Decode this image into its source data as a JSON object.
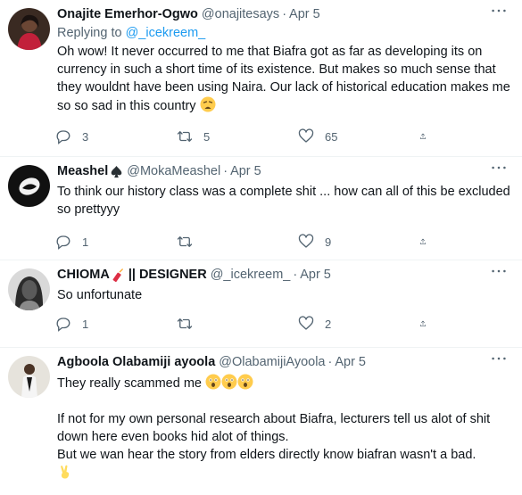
{
  "tweets": [
    {
      "name": "Onajite Emerhor-Ogwo",
      "handle": "@onajitesays",
      "time": "Apr 5",
      "replying_label": "Replying to",
      "replying_handle": "@_icekreem_",
      "text": "Oh wow! It never occurred to me that Biafra got as far as developing its on currency in such a short time of its existence. But makes so much sense that they wouldnt have been using Naira. Our lack of historical education makes me so so sad in this country",
      "text_emoji": "weary-face",
      "replies": "3",
      "retweets": "5",
      "likes": "65"
    },
    {
      "name": "Meashel",
      "name_emoji": "spade-suit",
      "handle": "@MokaMeashel",
      "time": "Apr 5",
      "text": "To think our history class was a complete shit ... how can all of this be excluded so prettyyy",
      "replies": "1",
      "retweets": "",
      "likes": "9"
    },
    {
      "name": "CHIOMA",
      "name_emoji": "firecracker",
      "name_suffix": "|| DESIGNER",
      "handle": "@_icekreem_",
      "time": "Apr 5",
      "text": "So unfortunate",
      "replies": "1",
      "retweets": "",
      "likes": "2"
    },
    {
      "name": "Agboola Olabamiji ayoola",
      "handle": "@OlabamijiAyoola",
      "time": "Apr 5",
      "text1": "They really scammed me",
      "text1_emoji": "astonished-face x3",
      "text2": "If not for my own personal research about Biafra, lecturers tell us alot of shit down here even books hid alot of things.",
      "text3": "But we wan hear the story from elders directly know biafran wasn't a bad.",
      "text3_emoji": "victory-hand"
    }
  ],
  "icons": {
    "reply": "reply-icon",
    "retweet": "retweet-icon",
    "like": "heart-icon",
    "share": "share-icon",
    "more": "more-icon"
  },
  "colors": {
    "text": "#0f1419",
    "secondary": "#536471",
    "link": "#1d9bf0",
    "divider": "#eff3f4"
  }
}
